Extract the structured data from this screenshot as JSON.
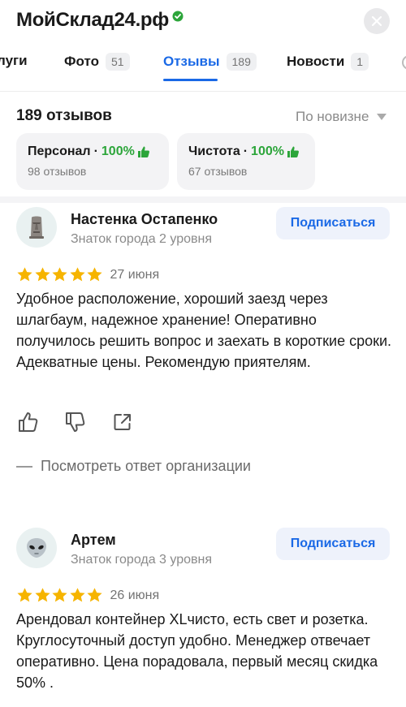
{
  "header": {
    "title": "МойСклад24.рф"
  },
  "tabs": [
    {
      "label": "луги",
      "count": ""
    },
    {
      "label": "Фото",
      "count": "51"
    },
    {
      "label": "Отзывы",
      "count": "189"
    },
    {
      "label": "Новости",
      "count": "1"
    }
  ],
  "summary": {
    "reviews_count": "189 отзывов",
    "sort_label": "По новизне"
  },
  "categories": [
    {
      "name": "Персонал",
      "percent": "100%",
      "reviews": "98 отзывов"
    },
    {
      "name": "Чистота",
      "percent": "100%",
      "reviews": "67 отзывов"
    }
  ],
  "reviews": [
    {
      "author": "Настенка Остапенко",
      "level": "Знаток города 2 уровня",
      "subscribe_label": "Подписаться",
      "rating": 5,
      "date": "27 июня",
      "text": "Удобное расположение, хороший заезд через шлагбаум, надежное хранение! Оперативно получилось решить вопрос и заехать в короткие сроки. Адекватные цены. Рекомендую приятелям.",
      "org_reply_label": "Посмотреть ответ организации",
      "avatar_icon": "moai-icon"
    },
    {
      "author": "Артем",
      "level": "Знаток города 3 уровня",
      "subscribe_label": "Подписаться",
      "rating": 5,
      "date": "26 июня",
      "text": "Арендовал контейнер XLчисто, есть свет и розетка. Круглосуточный доступ удобно. Менеджер отвечает оперативно. Цена порадовала, первый месяц скидка 50% .",
      "avatar_icon": "alien-icon"
    }
  ],
  "colors": {
    "accent": "#1a69e6",
    "positive": "#2ca53a",
    "star": "#f6b400"
  }
}
